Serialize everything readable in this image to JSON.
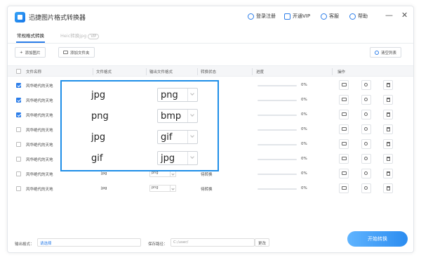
{
  "app": {
    "title": "迅捷图片格式转换器"
  },
  "titlebar": {
    "login": "登录注册",
    "vip": "开通VIP",
    "help": "客服",
    "about": "帮助",
    "minimize": "—",
    "close": "✕"
  },
  "tabs": [
    {
      "label": "常规格式转换",
      "active": true
    },
    {
      "label": "Heic转换jpg",
      "badge": "VIP",
      "active": false
    }
  ],
  "toolbar": {
    "add_image": "添加图片",
    "add_folder": "添加文件夹",
    "clear_list": "清空列表"
  },
  "table": {
    "headers": [
      "文件名称",
      "文件格式",
      "输出文件格式",
      "转换状态",
      "进度",
      "操作"
    ],
    "rows": [
      {
        "name": "风华绝代的天地",
        "checked": true,
        "format": "jpg",
        "output": "png",
        "status": "待转换",
        "progress": "0%",
        "progress_value": 0
      },
      {
        "name": "风华绝代的天地",
        "checked": true,
        "format": "png",
        "output": "bmp",
        "status": "待转换",
        "progress": "0%",
        "progress_value": 0
      },
      {
        "name": "风华绝代的天地",
        "checked": true,
        "format": "jpg",
        "output": "gif",
        "status": "待转换",
        "progress": "0%",
        "progress_value": 0
      },
      {
        "name": "风华绝代的天地",
        "checked": false,
        "format": "gif",
        "output": "jpg",
        "status": "待转换",
        "progress": "0%",
        "progress_value": 0
      },
      {
        "name": "风华绝代的天地",
        "checked": false,
        "format": "jpg",
        "output": "png",
        "status": "待转换",
        "progress": "0%",
        "progress_value": 0
      },
      {
        "name": "风华绝代的天地",
        "checked": false,
        "format": "jpg",
        "output": "png",
        "status": "待转换",
        "progress": "0%",
        "progress_value": 0
      },
      {
        "name": "风华绝代的天地",
        "checked": false,
        "format": "jpg",
        "output": "png",
        "status": "待转换",
        "progress": "0%",
        "progress_value": 0
      },
      {
        "name": "风华绝代的天地",
        "checked": false,
        "format": "jpg",
        "output": "png",
        "status": "待转换",
        "progress": "0%",
        "progress_value": 0
      }
    ]
  },
  "overlay": {
    "rows": [
      {
        "source": "jpg",
        "target": "png"
      },
      {
        "source": "png",
        "target": "bmp"
      },
      {
        "source": "jpg",
        "target": "gif"
      },
      {
        "source": "gif",
        "target": "jpg"
      }
    ]
  },
  "footer": {
    "output_format_label": "输出格式：",
    "output_format_value": "请选择",
    "save_path_label": "保存路径：",
    "save_path_value": "C:/user/",
    "change_button": "更改",
    "start_button": "开始转换"
  },
  "colors": {
    "accent": "#2b7de9",
    "overlay_border": "#1e8ee8"
  }
}
